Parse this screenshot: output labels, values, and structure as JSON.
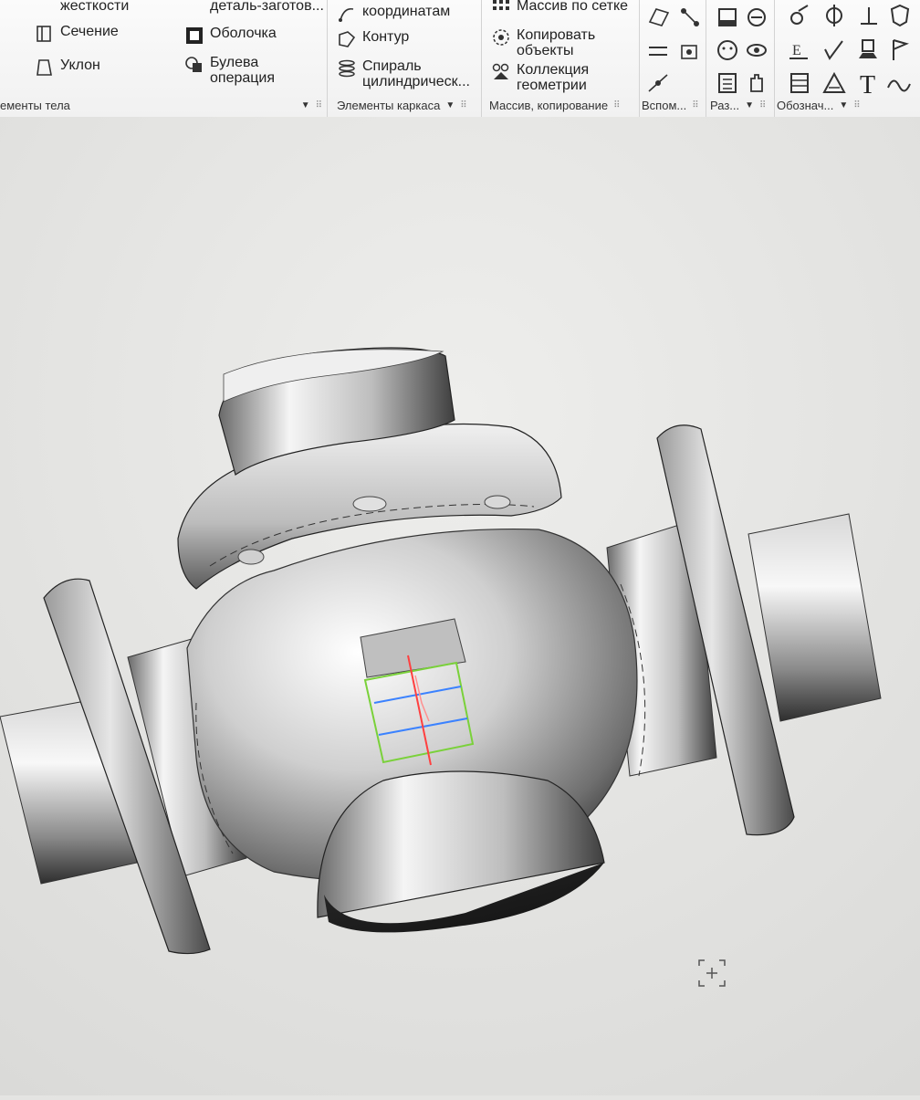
{
  "ribbon": {
    "groups": [
      {
        "id": "body",
        "label": "ементы тела",
        "items": [
          {
            "label": "жесткости",
            "icon": "rib-icon"
          },
          {
            "label": "Сечение",
            "icon": "section-icon"
          },
          {
            "label": "Уклон",
            "icon": "draft-icon"
          },
          {
            "label": "деталь-заготов...",
            "icon": "blank-part-icon"
          },
          {
            "label": "Оболочка",
            "icon": "shell-icon"
          },
          {
            "label": "Булева\nоперация",
            "icon": "boolean-icon"
          }
        ]
      },
      {
        "id": "wireframe",
        "label": "Элементы каркаса",
        "items": [
          {
            "label": "координатам",
            "icon": "coord-curve-icon"
          },
          {
            "label": "Контур",
            "icon": "contour-icon"
          },
          {
            "label": "Спираль\nцилиндрическ...",
            "icon": "helix-icon"
          }
        ]
      },
      {
        "id": "pattern",
        "label": "Массив, копирование",
        "items": [
          {
            "label": "Массив по сетке",
            "icon": "grid-array-icon"
          },
          {
            "label": "Копировать\nобъекты",
            "icon": "copy-objects-icon"
          },
          {
            "label": "Коллекция\nгеометрии",
            "icon": "geometry-collection-icon"
          }
        ]
      },
      {
        "id": "aux",
        "label": "Вспом...",
        "items": []
      },
      {
        "id": "sketch",
        "label": "Раз...",
        "items": []
      },
      {
        "id": "notation",
        "label": "Обознач...",
        "items": []
      }
    ]
  },
  "view_toolbar": {
    "buttons": [
      {
        "id": "grid",
        "icon": "grid-icon"
      },
      {
        "id": "local-cs",
        "icon": "local-cs-icon"
      },
      {
        "id": "zoom",
        "icon": "zoom-icon"
      },
      {
        "id": "move",
        "icon": "move-icon"
      },
      {
        "id": "orient",
        "icon": "orientation-icon"
      },
      {
        "id": "shaded",
        "icon": "shaded-cube-icon"
      },
      {
        "id": "wire",
        "icon": "wireframe-cube-icon"
      },
      {
        "id": "hide",
        "icon": "hide-icon"
      },
      {
        "id": "display",
        "icon": "display-icon"
      },
      {
        "id": "constraints",
        "icon": "constraints-icon"
      },
      {
        "id": "layers",
        "icon": "layers-icon"
      }
    ]
  },
  "colors": {
    "ribbon_bg": "#f4f4f4",
    "viewport_bg": "#e4e4e2",
    "model_gray": "#b8b8b8",
    "axis_red": "#ff4040",
    "axis_green": "#7ad13a",
    "axis_blue": "#3b82ff"
  }
}
